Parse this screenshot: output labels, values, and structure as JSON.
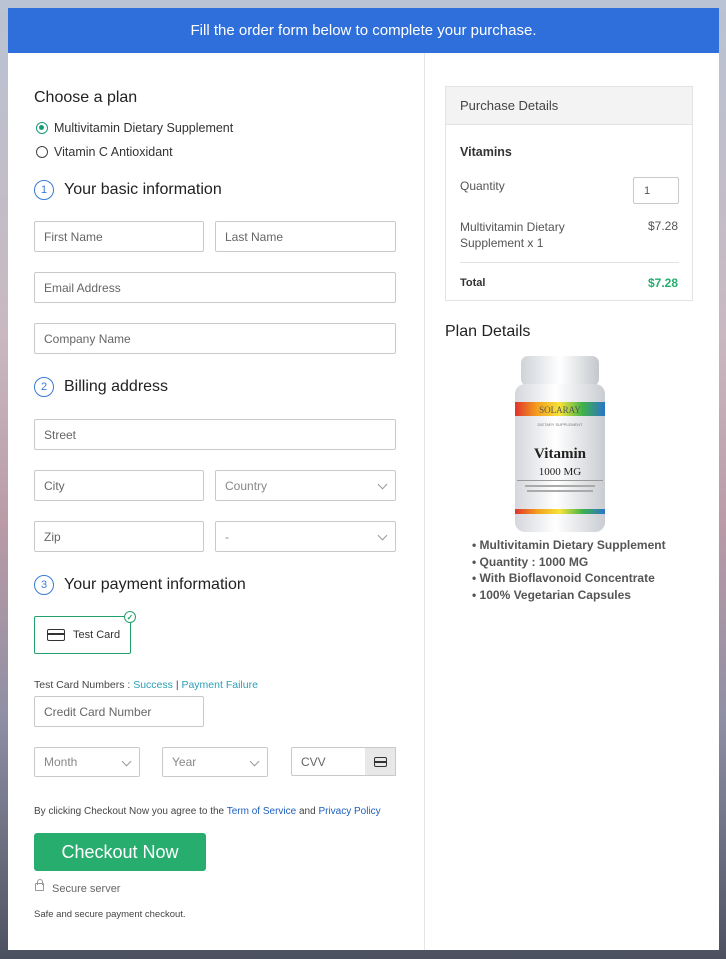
{
  "banner": "Fill the order form below to complete your purchase.",
  "plan": {
    "heading": "Choose a plan",
    "options": [
      "Multivitamin Dietary Supplement",
      "Vitamin C Antioxidant"
    ],
    "selected_index": 0
  },
  "basic": {
    "number": "1",
    "heading": "Your basic information",
    "first_name": "First Name",
    "last_name": "Last Name",
    "email": "Email Address",
    "company": "Company Name"
  },
  "billing": {
    "number": "2",
    "heading": "Billing address",
    "street": "Street",
    "city": "City",
    "country": "Country",
    "zip": "Zip",
    "state": "-"
  },
  "payment": {
    "number": "3",
    "heading": "Your payment information",
    "test_card": "Test Card",
    "test_numbers_label": "Test Card Numbers :",
    "success_link": "Success",
    "separator": "|",
    "failure_link": "Payment Failure",
    "card_number": "Credit Card Number",
    "month": "Month",
    "year": "Year",
    "cvv": "CVV"
  },
  "terms": {
    "prefix": "By clicking Checkout Now you agree to the",
    "tos": "Term of Service",
    "and": "and",
    "privacy": "Privacy Policy"
  },
  "checkout_label": "Checkout Now",
  "secure_server": "Secure server",
  "secure_note": "Safe and secure payment checkout.",
  "purchase": {
    "heading": "Purchase Details",
    "product_group": "Vitamins",
    "quantity_label": "Quantity",
    "quantity_value": "1",
    "item_name_line1": "Multivitamin Dietary",
    "item_name_line2": "Supplement x 1",
    "item_price": "$7.28",
    "total_label": "Total",
    "total_value": "$7.28"
  },
  "plan_details": {
    "heading": "Plan Details",
    "bottle_brand": "SOLARAY",
    "bottle_sub": "DIETARY SUPPLEMENT",
    "bottle_title": "Vitamin",
    "bottle_dose": "1000 MG",
    "features": [
      "Multivitamin Dietary Supplement",
      "Quantity : 1000 MG",
      "With Bioflavonoid Concentrate",
      "100% Vegetarian Capsules"
    ]
  },
  "colors": {
    "banner": "#2e6fdc",
    "accent_green": "#27ae6e",
    "step_blue": "#3a7bd5",
    "link_teal": "#2aa0b6"
  }
}
